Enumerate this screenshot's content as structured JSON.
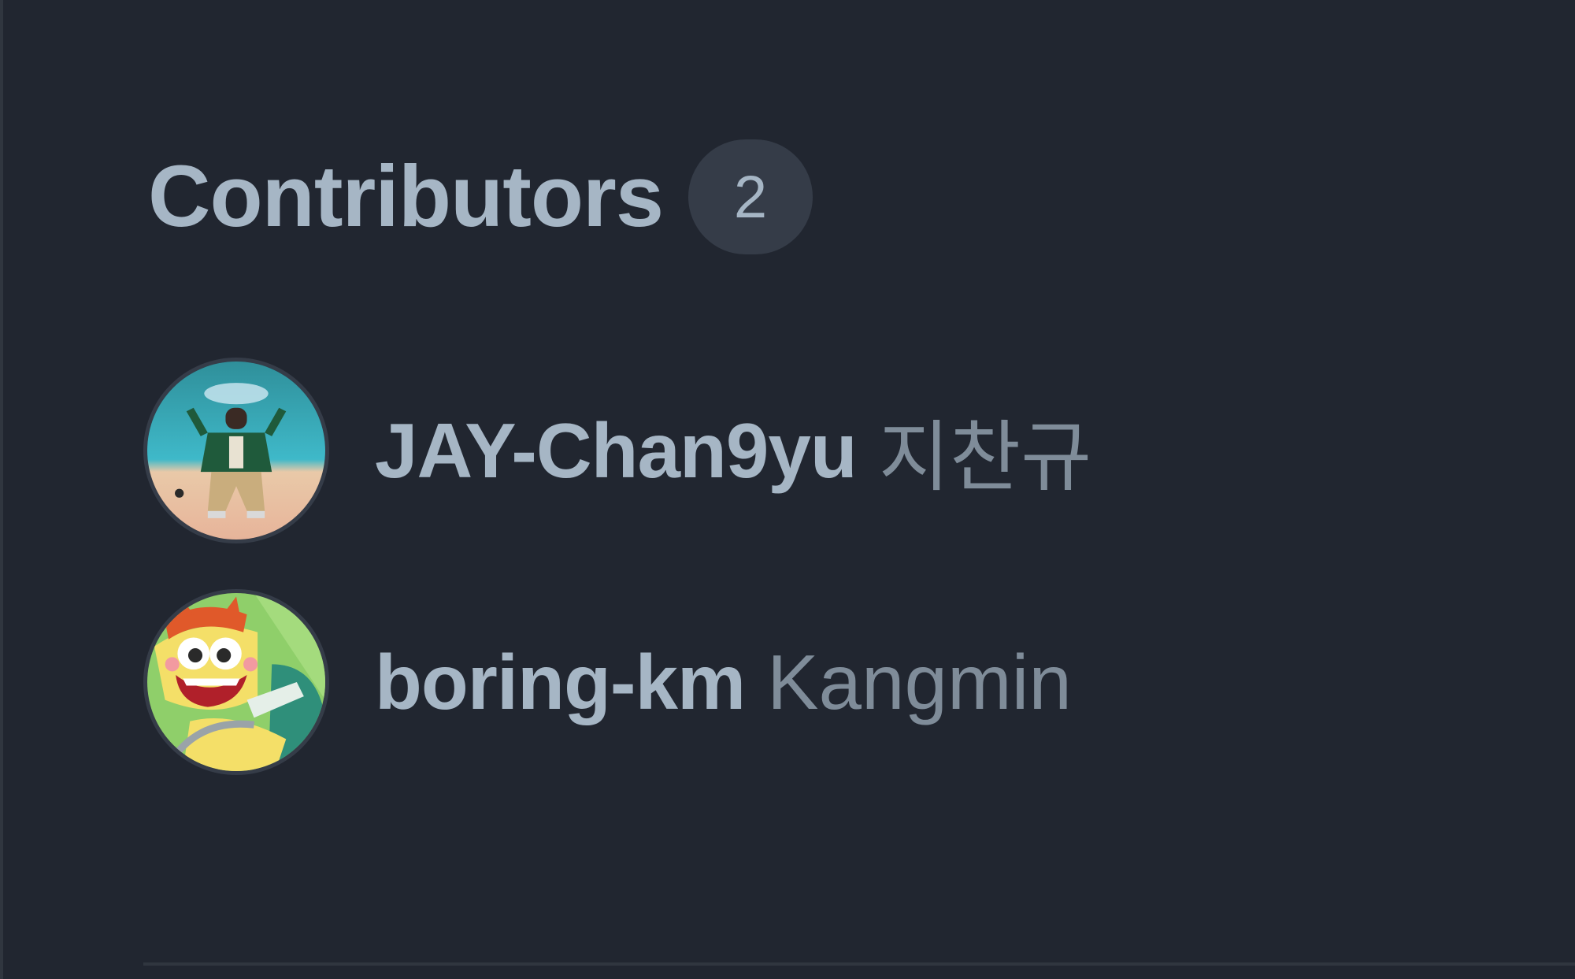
{
  "contributors_section": {
    "title": "Contributors",
    "count": "2",
    "items": [
      {
        "login": "JAY-Chan9yu",
        "name": "지찬규",
        "avatar_icon": "person-photo-avatar"
      },
      {
        "login": "boring-km",
        "name": "Kangmin",
        "avatar_icon": "cartoon-avatar"
      }
    ]
  },
  "colors": {
    "background": "#212630",
    "text_primary": "#a6b6c5",
    "text_secondary": "#7f8c99",
    "counter_bg": "#353c48",
    "border": "#30363f"
  }
}
